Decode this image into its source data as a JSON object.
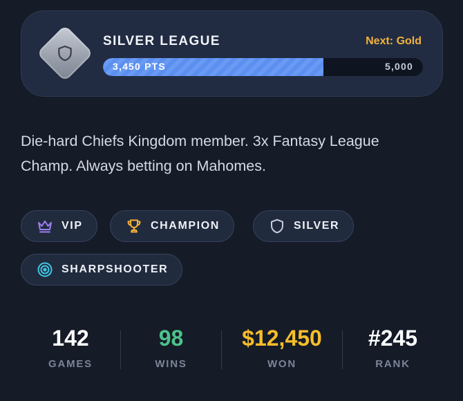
{
  "league": {
    "title": "SILVER LEAGUE",
    "next_label": "Next: Gold",
    "points_label": "3,450 PTS",
    "goal_label": "5,000",
    "progress_fraction": 0.69,
    "badge_icon": "shield-icon"
  },
  "bio": "Die-hard Chiefs Kingdom member. 3x Fantasy League Champ. Always betting on Mahomes.",
  "badges": [
    {
      "label": "VIP",
      "icon": "crown-icon",
      "color": "#9d7ff0"
    },
    {
      "label": "CHAMPION",
      "icon": "trophy-icon",
      "color": "#f3b23a"
    },
    {
      "label": "SILVER",
      "icon": "shield-icon",
      "color": "#c8cfdb"
    },
    {
      "label": "SHARPSHOOTER",
      "icon": "target-icon",
      "color": "#3fc7e6"
    }
  ],
  "stats": [
    {
      "value": "142",
      "label": "GAMES",
      "color": "#ffffff"
    },
    {
      "value": "98",
      "label": "WINS",
      "color": "#4cc38a"
    },
    {
      "value": "$12,450",
      "label": "WON",
      "color": "#f6bd2b"
    },
    {
      "value": "#245",
      "label": "RANK",
      "color": "#ffffff"
    }
  ]
}
